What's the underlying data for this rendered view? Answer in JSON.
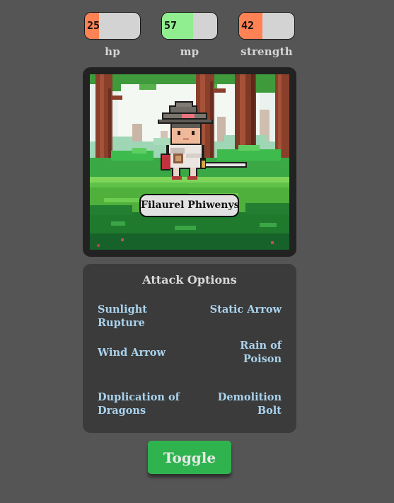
{
  "stats": [
    {
      "key": "hp",
      "label": "hp",
      "value": "25",
      "fraction": 0.25,
      "color": "#ff8254"
    },
    {
      "key": "mp",
      "label": "mp",
      "value": "57",
      "fraction": 0.57,
      "color": "#90ee90"
    },
    {
      "key": "strength",
      "label": "strength",
      "value": "42",
      "fraction": 0.42,
      "color": "#ff8254"
    }
  ],
  "character": {
    "name": "Filaurel Phiwenys"
  },
  "attack_panel": {
    "title": "Attack Options",
    "options": [
      "Sunlight Rupture",
      "Static Arrow",
      "Wind Arrow",
      "Rain of Poison",
      "Duplication of Dragons",
      "Demolition Bolt"
    ]
  },
  "toggle_label": "Toggle"
}
